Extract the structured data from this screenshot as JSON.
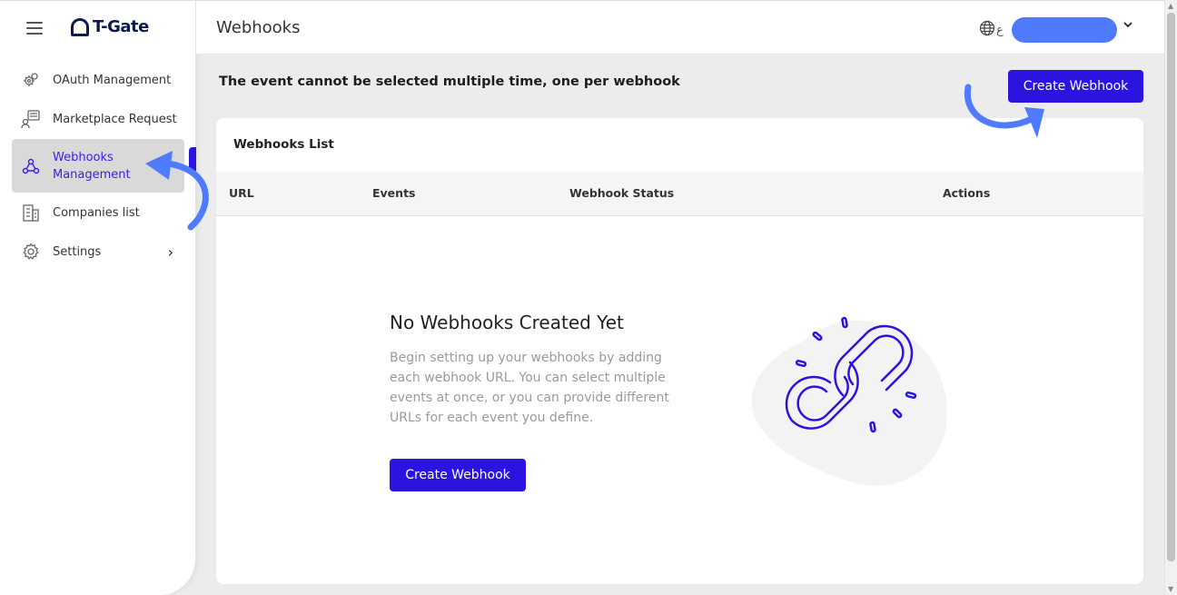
{
  "app": {
    "logo_text": "T-Gate"
  },
  "sidebar": {
    "items": [
      {
        "label": "OAuth Management",
        "icon": "gears-icon"
      },
      {
        "label": "Marketplace Request",
        "icon": "user-chat-icon"
      },
      {
        "label": "Webhooks Management",
        "icon": "webhook-icon",
        "active": true
      },
      {
        "label": "Companies list",
        "icon": "building-icon"
      },
      {
        "label": "Settings",
        "icon": "gear-icon"
      }
    ]
  },
  "header": {
    "title": "Webhooks",
    "lang_label": "ع"
  },
  "main": {
    "notice": "The event cannot be selected multiple time, one per webhook",
    "create_button": "Create Webhook",
    "card": {
      "title": "Webhooks List",
      "columns": [
        "URL",
        "Events",
        "Webhook Status",
        "Actions"
      ],
      "empty": {
        "title": "No Webhooks Created Yet",
        "description": "Begin setting up your webhooks by adding each webhook URL. You can select multiple events at once, or you can provide different URLs for each event you define.",
        "button": "Create Webhook"
      }
    }
  },
  "colors": {
    "accent": "#2b14e0",
    "annotation_arrow": "#4f7cff",
    "active_bg": "#d9d9d9"
  }
}
